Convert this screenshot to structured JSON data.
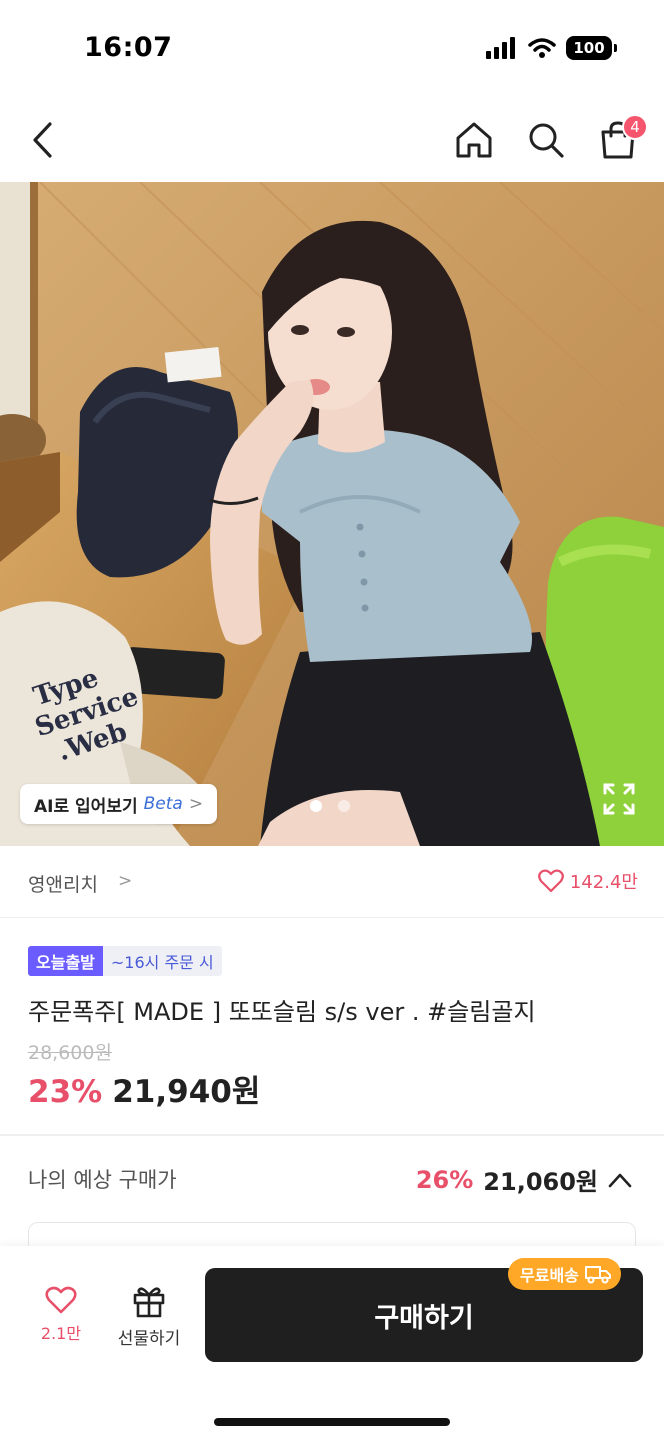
{
  "status_bar": {
    "time": "16:07",
    "battery": "100"
  },
  "nav": {
    "cart_count": "4"
  },
  "hero": {
    "ai_tryon_label": "AI로 입어보기",
    "ai_tryon_beta": "Beta",
    "chevron": ">",
    "page_count": 2,
    "active_page": 1,
    "cap_text": [
      "Type",
      "Service",
      ".Web"
    ]
  },
  "brand": {
    "name": "영앤리치",
    "chevron": ">",
    "likes": "142.4만"
  },
  "product": {
    "badge_today": "오늘출발",
    "badge_time": "~16시 주문 시",
    "title": "주문폭주[ MADE ] 또또슬림 s/s ver . #슬림골지",
    "original_price": "28,600원",
    "discount": "23%",
    "price": "21,940원"
  },
  "expected": {
    "label": "나의 예상 구매가",
    "discount": "26%",
    "price": "21,060원"
  },
  "bottom_bar": {
    "like_count": "2.1만",
    "gift_label": "선물하기",
    "buy_label": "구매하기",
    "free_shipping": "무료배송"
  },
  "colors": {
    "accent_pink": "#e8506a",
    "badge_purple": "#6b5cff",
    "buy_dark": "#1f1f1f",
    "ship_orange": "#ffa726"
  }
}
